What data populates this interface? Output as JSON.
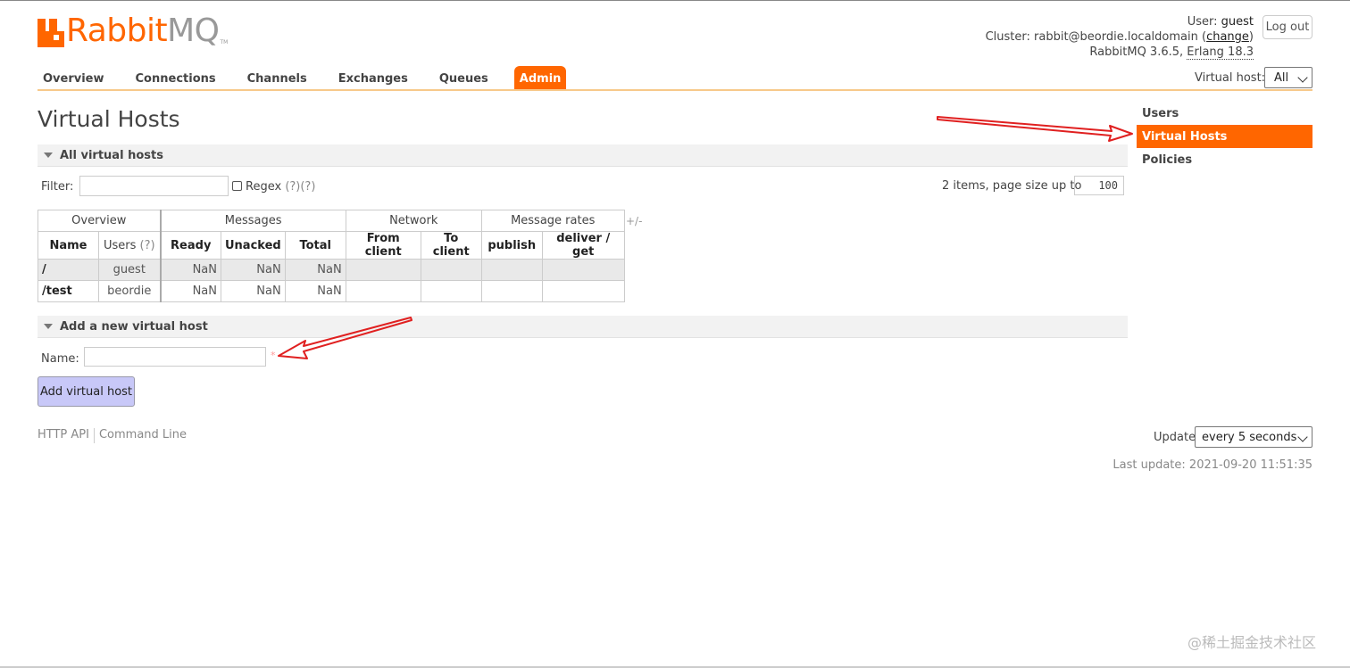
{
  "logo": {
    "rabbit": "Rabbit",
    "mq": "MQ",
    "tm": "TM"
  },
  "header": {
    "user_label": "User:",
    "user": "guest",
    "cluster_label": "Cluster:",
    "cluster": "rabbit@beordie.localdomain",
    "change_open": "(",
    "change": "change",
    "change_close": ")",
    "version": "RabbitMQ 3.6.5,",
    "erlang": "Erlang 18.3",
    "logout": "Log out"
  },
  "nav": {
    "tabs": [
      "Overview",
      "Connections",
      "Channels",
      "Exchanges",
      "Queues",
      "Admin"
    ],
    "active": "Admin",
    "vhost_label": "Virtual host:",
    "vhost_value": "All"
  },
  "page": {
    "title": "Virtual Hosts"
  },
  "sidebar": {
    "items": [
      "Users",
      "Virtual Hosts",
      "Policies"
    ],
    "active": "Virtual Hosts"
  },
  "all_vhosts": {
    "heading": "All virtual hosts",
    "filter_label": "Filter:",
    "regex_label": "Regex",
    "regex_help": "(?)(?)",
    "items_text": "2 items, page size up to",
    "page_size": "100",
    "plus_minus": "+/-",
    "table": {
      "groups": [
        "Overview",
        "Messages",
        "Network",
        "Message rates"
      ],
      "columns": [
        "Name",
        "Users",
        "(?)",
        "Ready",
        "Unacked",
        "Total",
        "From client",
        "To client",
        "publish",
        "deliver / get"
      ],
      "rows": [
        {
          "name": "/",
          "users": "guest",
          "ready": "NaN",
          "unacked": "NaN",
          "total": "NaN",
          "from_client": "",
          "to_client": "",
          "publish": "",
          "deliver_get": ""
        },
        {
          "name": "/test",
          "users": "beordie",
          "ready": "NaN",
          "unacked": "NaN",
          "total": "NaN",
          "from_client": "",
          "to_client": "",
          "publish": "",
          "deliver_get": ""
        }
      ]
    }
  },
  "add_vhost": {
    "heading": "Add a new virtual host",
    "name_label": "Name:",
    "required_mark": "*",
    "button": "Add virtual host"
  },
  "footer": {
    "links": [
      "HTTP API",
      "Command Line"
    ],
    "update_label": "Update",
    "update_value": "every 5 seconds",
    "last_update": "Last update: 2021-09-20 11:51:35"
  },
  "annotation_color": "#e02020",
  "watermark": "@稀土掘金技术社区"
}
